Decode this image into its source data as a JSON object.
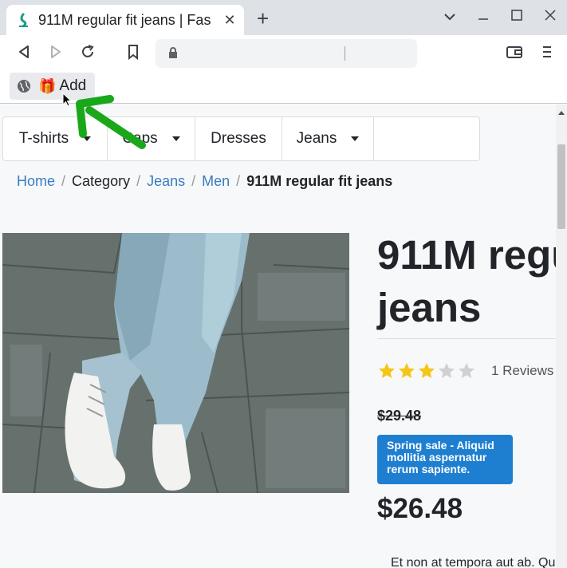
{
  "browser": {
    "tab_title": "911M regular fit jeans | Fas",
    "tab_close": "✕",
    "new_tab": "+",
    "window_controls": {
      "dropdown": "⌄",
      "minimize": "—",
      "maximize": "☐",
      "close": "✕"
    },
    "bookmark": {
      "label": "Add",
      "gift_glyph": "🎁"
    }
  },
  "nav": {
    "items": [
      {
        "label": "T-shirts",
        "has_caret": true
      },
      {
        "label": "Caps",
        "has_caret": true
      },
      {
        "label": "Dresses",
        "has_caret": false
      },
      {
        "label": "Jeans",
        "has_caret": true
      }
    ]
  },
  "breadcrumb": {
    "home": "Home",
    "category": "Category",
    "jeans": "Jeans",
    "men": "Men",
    "current": "911M regular fit jeans",
    "separator": "/"
  },
  "product": {
    "title_line1": "911M regu",
    "title_line2": "jeans",
    "rating": 3,
    "rating_max": 5,
    "reviews": "1 Reviews",
    "old_price": "$29.48",
    "sale_badge": "Spring sale - Aliquid mollitia aspernatur rerum sapiente.",
    "price": "$26.48",
    "description": "Et non at tempora aut ab. Qua"
  },
  "colors": {
    "accent": "#1e7fd1",
    "link": "#3a7bbf",
    "star_filled": "#f5c518",
    "star_empty": "#d0d0d0",
    "annotation_arrow": "#1aa81a"
  }
}
